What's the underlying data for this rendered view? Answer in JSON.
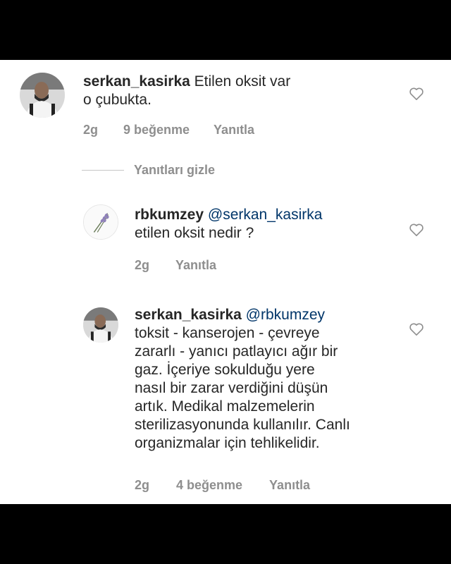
{
  "comments": [
    {
      "username": "serkan_kasirka",
      "mention": "",
      "lines": [
        "Etilen oksit var",
        "o çubukta."
      ],
      "time": "2g",
      "likes": "9 beğenme",
      "reply_label": "Yanıtla"
    },
    {
      "username": "rbkumzey",
      "mention": "@serkan_kasirka",
      "lines": [
        "etilen oksit nedir ?"
      ],
      "time": "2g",
      "likes": "",
      "reply_label": "Yanıtla"
    },
    {
      "username": "serkan_kasirka",
      "mention": "@rbkumzey",
      "lines": [
        "toksit - kanserojen - çevreye",
        "zararlı - yanıcı patlayıcı ağır bir",
        "gaz.  İçeriye sokulduğu yere",
        "nasıl bir zarar verdiğini düşün",
        "artık.  Medikal malzemelerin",
        "sterilizasyonunda kullanılır. Canlı",
        "organizmalar için tehlikelidir."
      ],
      "time": "2g",
      "likes": "4 beğenme",
      "reply_label": "Yanıtla"
    }
  ],
  "hide_replies_label": "Yanıtları gizle",
  "icons": {
    "like": "heart-outline-icon",
    "avatar_user": "person-avatar",
    "avatar_lavender": "lavender-avatar"
  },
  "colors": {
    "text": "#262626",
    "meta": "#8e8e8e",
    "mention": "#003569",
    "frame": "#000000"
  }
}
